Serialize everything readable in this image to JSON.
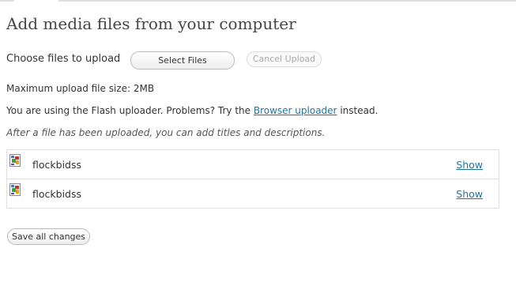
{
  "header": {
    "title": "Add media files from your computer"
  },
  "upload": {
    "choose_label": "Choose files to upload",
    "select_files_label": "Select Files",
    "cancel_upload_label": "Cancel Upload"
  },
  "info": {
    "max_size_text": "Maximum upload file size: 2MB",
    "flash_prefix": "You are using the Flash uploader. Problems? Try the ",
    "browser_uploader_link": "Browser uploader",
    "flash_suffix": " instead.",
    "after_upload_note": "After a file has been uploaded, you can add titles and descriptions."
  },
  "files": [
    {
      "name": "flockbidss",
      "show_label": "Show",
      "icon": "broken-image-icon"
    },
    {
      "name": "flockbidss",
      "show_label": "Show",
      "icon": "broken-image-icon"
    }
  ],
  "footer": {
    "save_all_label": "Save all changes"
  },
  "colors": {
    "link": "#21759b",
    "title": "#464646",
    "border": "#dfdfdf"
  }
}
